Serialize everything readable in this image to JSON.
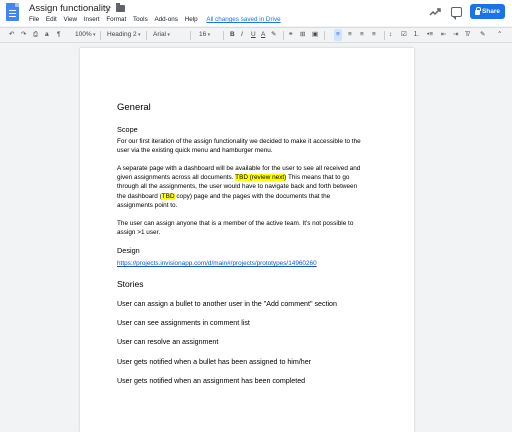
{
  "header": {
    "title": "Assign functionality",
    "menu": [
      "File",
      "Edit",
      "View",
      "Insert",
      "Format",
      "Tools",
      "Add-ons",
      "Help"
    ],
    "saved_status": "All changes saved in Drive",
    "share_label": "Share"
  },
  "toolbar": {
    "zoom": "100%",
    "style": "Heading 2",
    "font": "Arial",
    "font_size": "16",
    "bold": "B",
    "italic": "I",
    "underline": "U",
    "text_color": "A"
  },
  "doc": {
    "heading": "General",
    "scope_title": "Scope",
    "scope_lines": [
      "For our first iteration of the assign functionality we decided to make it accessible to the",
      "user via the existing quick menu and hamburger menu."
    ],
    "para2": {
      "line1": "A separate page with a dashboard will be available for the user to see all received and",
      "line2_pre": "given assignments across all documents. ",
      "line2_hl": "TBD (review next)",
      "line2_post": " This means that to go",
      "line3": "through all the  assignments, the user would have to navigate back and forth between",
      "line4_pre": "the dashboard (",
      "line4_hl": "TBD",
      "line4_post": " copy) page and the pages with the documents that the",
      "line5": "assignments point to."
    },
    "para3": [
      "The user can assign anyone that is a member of the active team. It's not possible to",
      "assign >1 user."
    ],
    "design_title": "Design",
    "design_link": "https://projects.invisionapp.com/d/main#/projects/prototypes/14960260",
    "stories_title": "Stories",
    "stories": [
      "User can assign a bullet to another user in the \"Add comment\" section",
      "User can see assignments in comment list",
      "User can resolve an assignment",
      "User gets notified when a bullet has been assigned to him/her",
      "User gets notified when an assignment has been completed"
    ]
  },
  "colors": {
    "accent": "#1a73e8",
    "highlight": "#ffff00",
    "link": "#1155cc"
  }
}
